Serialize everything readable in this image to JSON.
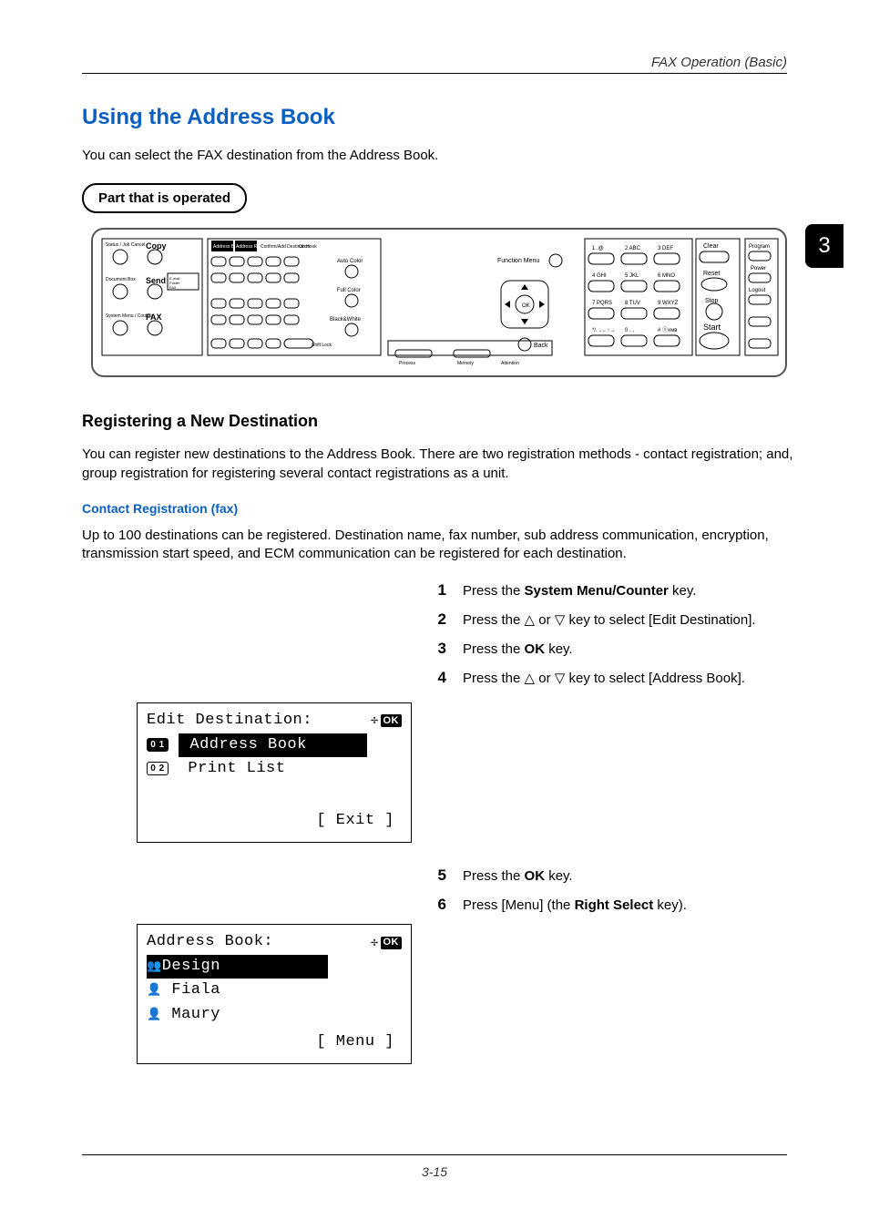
{
  "running_header": "FAX Operation (Basic)",
  "side_tab": "3",
  "h1": "Using the Address Book",
  "intro": "You can select the FAX destination from the Address Book.",
  "part_badge": "Part that is operated",
  "panel": {
    "left_keys": [
      "Copy",
      "Send",
      "FAX"
    ],
    "left_small": [
      "Status / Job Cancel",
      "Document Box",
      "System Menu / Counter"
    ],
    "addr_row": [
      "Address Book",
      "Address Recall/Pause",
      "Confirm/Add Destination",
      "On Hook"
    ],
    "addr_sub": [
      "E-mail",
      "Folder",
      "FAX"
    ],
    "color_col": [
      "Auto Color",
      "Full Color",
      "Black&White"
    ],
    "shift_lock": "Shift Lock",
    "function_menu": "Function Menu",
    "back": "Back",
    "status_leds": [
      "Process",
      "Memory",
      "Attention"
    ],
    "keypad": [
      "1 .@",
      "2 ABC",
      "3 DEF",
      "4 GHI",
      "5 JKL",
      "6 MNO",
      "7 PQRS",
      "8 TUV",
      "9 WXYZ",
      "*/. ↓←↑→",
      "0 . ,",
      "# ⓢʏᴍʙ"
    ],
    "right_col": [
      "Clear",
      "Reset",
      "Stop",
      "Start"
    ],
    "far_right": [
      "Program",
      "Power",
      "Logout"
    ]
  },
  "h2": "Registering a New Destination",
  "reg_intro": "You can register new destinations to the Address Book. There are two registration methods - contact registration; and, group registration for registering several contact registrations as a unit.",
  "h3": "Contact Registration (fax)",
  "contact_intro": "Up to 100 destinations can be registered. Destination name, fax number, sub address communication, encryption, transmission start speed, and ECM communication can be registered for each destination.",
  "steps": {
    "s1_a": "Press the ",
    "s1_b": "System Menu/Counter",
    "s1_c": " key.",
    "s2_a": "Press the ",
    "s2_b": " or ",
    "s2_c": " key to select [Edit Destination].",
    "s3_a": "Press the ",
    "s3_b": "OK",
    "s3_c": " key.",
    "s4_a": "Press the ",
    "s4_b": " or ",
    "s4_c": " key to select [Address Book].",
    "s5_a": "Press the ",
    "s5_b": "OK",
    "s5_c": " key.",
    "s6_a": "Press [Menu] (the ",
    "s6_b": "Right Select",
    "s6_c": " key)."
  },
  "lcd1": {
    "title": "Edit Destination:",
    "row1_num": "0 1",
    "row1_text": "Address Book",
    "row2_num": "0 2",
    "row2_text": "Print List",
    "footer": "[  Exit  ]"
  },
  "lcd2": {
    "title": "Address Book:",
    "row1_text": "Design",
    "row2_text": "Fiala",
    "row3_text": "Maury",
    "footer": "[  Menu  ]"
  },
  "page_number": "3-15"
}
